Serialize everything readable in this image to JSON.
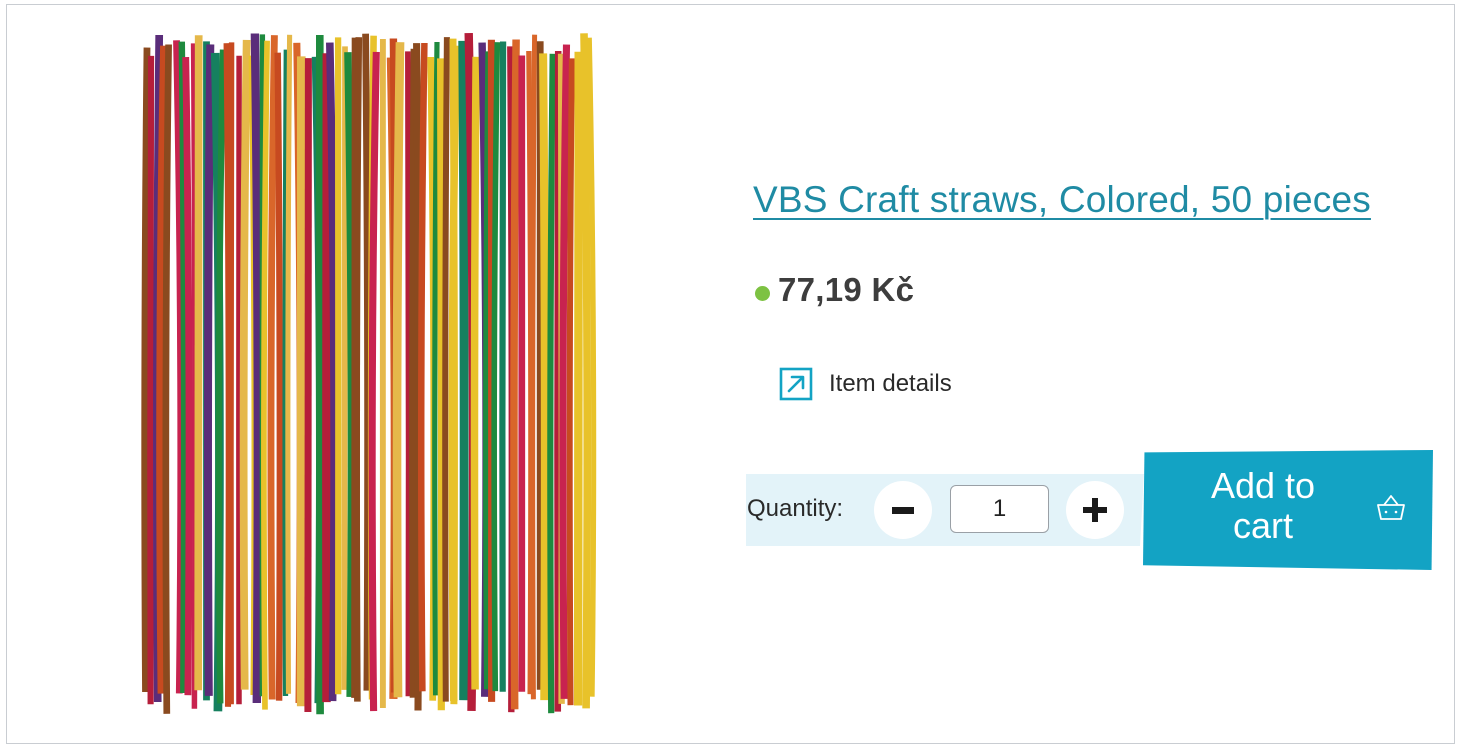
{
  "product": {
    "title": "VBS Craft straws, Colored, 50 pieces",
    "price": "77,19 Kč",
    "stock_color": "#7dc242",
    "details_label": "Item details",
    "details_icon": "external-link-arrow-icon",
    "image_alt": "Colored craft straws"
  },
  "quantity": {
    "label": "Quantity:",
    "value": "1",
    "minus_icon": "minus-icon",
    "plus_icon": "plus-icon"
  },
  "cart": {
    "label": "Add to cart",
    "icon": "basket-icon"
  },
  "colors": {
    "accent": "#13a3c4",
    "link": "#1f8ba4",
    "qty_bg": "#e3f3f9"
  }
}
